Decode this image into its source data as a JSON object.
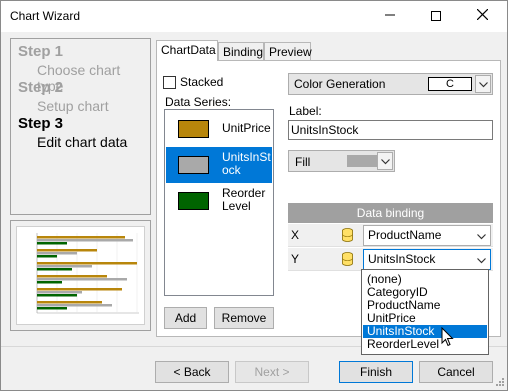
{
  "window": {
    "title": "Chart Wizard"
  },
  "steps": [
    {
      "title": "Step 1",
      "subtitle": "Choose chart type"
    },
    {
      "title": "Step 2",
      "subtitle": "Setup chart"
    },
    {
      "title": "Step 3",
      "subtitle": "Edit chart data"
    }
  ],
  "tabs": [
    {
      "label": "ChartData"
    },
    {
      "label": "Binding"
    },
    {
      "label": "Preview"
    }
  ],
  "chart_data_tab": {
    "stacked_label": "Stacked",
    "stacked_checked": false,
    "series_label": "Data Series:",
    "series": [
      {
        "label": "UnitPrice",
        "color": "#b8860b"
      },
      {
        "label": "UnitsInStock",
        "color": "#a9a9a9",
        "selected": true
      },
      {
        "label": "ReorderLevel",
        "color": "#006400"
      }
    ],
    "add_button": "Add",
    "remove_button": "Remove",
    "color_generation": {
      "label": "Color Generation",
      "value": "C"
    },
    "series_name_label": "Label:",
    "series_name_value": "UnitsInStock",
    "fill": {
      "label": "Fill",
      "color": "#a9a9a9"
    },
    "binding": {
      "header": "Data binding",
      "rows": [
        {
          "axis": "X",
          "value": "ProductName"
        },
        {
          "axis": "Y",
          "value": "UnitsInStock"
        }
      ],
      "dropdown_options": [
        "(none)",
        "CategoryID",
        "ProductName",
        "UnitPrice",
        "UnitsInStock",
        "ReorderLevel"
      ],
      "highlighted_option": "UnitsInStock"
    }
  },
  "footer": {
    "back": "< Back",
    "next": "Next >",
    "finish": "Finish",
    "cancel": "Cancel"
  },
  "colors": {
    "accent": "#0078d7",
    "header_gray": "#a0a0a0"
  }
}
